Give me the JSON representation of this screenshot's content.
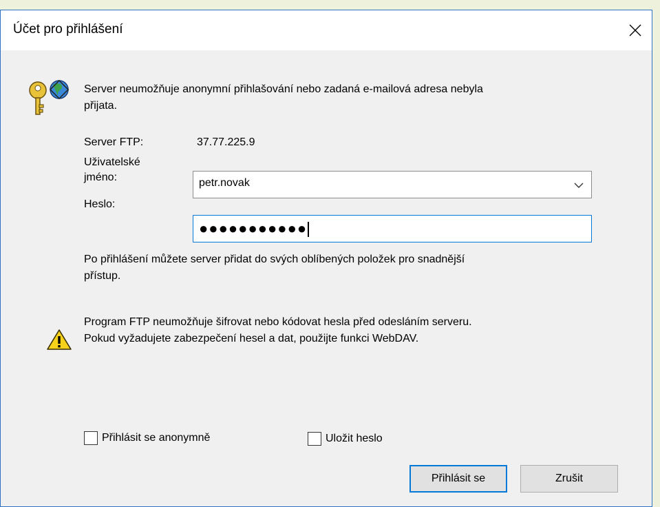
{
  "dialog": {
    "title": "Účet pro přihlášení"
  },
  "messages": {
    "error_line1": "Server neumožňuje anonymní přihlašování nebo zadaná e-mailová adresa nebyla",
    "error_line2": "přijata.",
    "favorites_line1": "Po přihlášení můžete server přidat do svých oblíbených položek pro snadnější",
    "favorites_line2": "přístup.",
    "warning_line1": "Program FTP neumožňuje šifrovat nebo kódovat hesla před odesláním serveru.",
    "warning_line2": "Pokud vyžadujete zabezpečení hesel a dat, použijte funkci WebDAV."
  },
  "form": {
    "server_label": "Server FTP:",
    "server_value": "37.77.225.9",
    "username_label_line1": "Uživatelské",
    "username_label_line2": "jméno:",
    "username_value": "petr.novak",
    "password_label": "Heslo:",
    "password_masked": "●●●●●●●●●●●"
  },
  "options": {
    "anonymous_label": "Přihlásit se anonymně",
    "save_password_label": "Uložit heslo"
  },
  "buttons": {
    "login": "Přihlásit se",
    "cancel": "Zrušit"
  },
  "icons": {
    "close": "close-icon",
    "keys": "keys-globe-icon",
    "warning": "warning-icon",
    "dropdown": "chevron-down-icon"
  },
  "colors": {
    "accent": "#0078d7",
    "window_border": "#2b71c6",
    "dialog_bg": "#f0f0f0"
  }
}
